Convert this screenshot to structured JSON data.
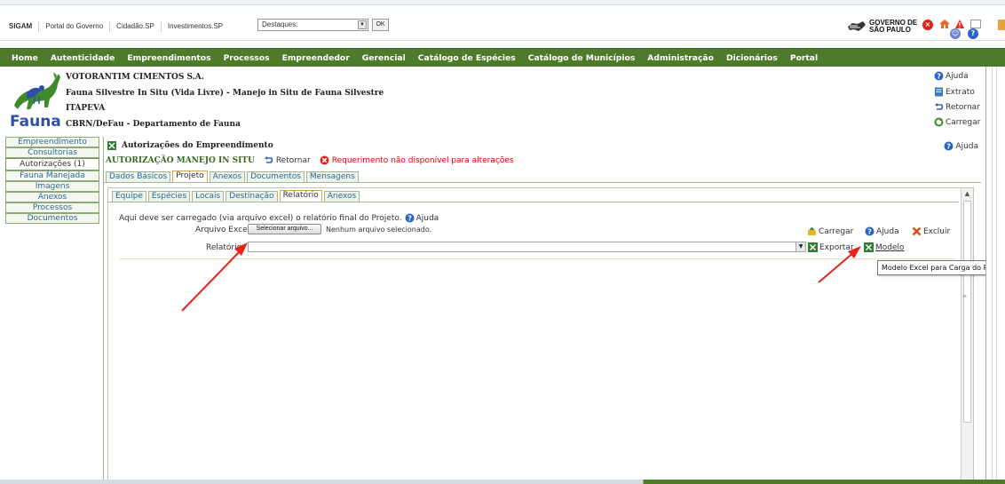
{
  "topbar": {
    "links": [
      "SIGAM",
      "Portal do Governo",
      "Cidadão.SP",
      "Investimentos.SP"
    ],
    "destaques_value": "Destaques:",
    "ok_label": "OK",
    "gov_logo_line1": "GOVERNO DE",
    "gov_logo_line2": "SÃO PAULO"
  },
  "mainnav": {
    "items": [
      "Home",
      "Autenticidade",
      "Empreendimentos",
      "Processos",
      "Empreendedor",
      "Gerencial",
      "Catálogo de Espécies",
      "Catálogo de Municípios",
      "Administração",
      "Dicionários",
      "Portal"
    ]
  },
  "header": {
    "company": "VOTORANTIM CIMENTOS S.A.",
    "activity": "Fauna Silvestre In Situ (Vida Livre) - Manejo in Situ de Fauna Silvestre",
    "city": "ITAPEVA",
    "department": "CBRN/DeFau - Departamento de Fauna",
    "logo_text": "Fauna",
    "actions": [
      "Ajuda",
      "Extrato",
      "Retornar",
      "Carregar"
    ]
  },
  "leftmenu": {
    "items": [
      "Empreendimento",
      "Consultorias",
      "Autorizações (1)",
      "Fauna Manejada",
      "Imagens",
      "Anexos",
      "Processos",
      "Documentos"
    ]
  },
  "content": {
    "section_title": "Autorizações do Empreendimento",
    "help_label": "Ajuda",
    "auth_title": "AUTORIZAÇÃO MANEJO IN SITU",
    "return_label": "Retornar",
    "warning": "Requerimento não disponível para alterações",
    "tabs": [
      "Dados Básicos",
      "Projeto",
      "Anexos",
      "Documentos",
      "Mensagens"
    ],
    "subtabs": [
      "Equipe",
      "Espécies",
      "Locais",
      "Destinação",
      "Relatório",
      "Anexos"
    ],
    "intro_text": "Aqui deve ser carregado (via arquivo excel) o relatório final do Projeto.",
    "intro_help": "Ajuda",
    "excel_label": "Arquivo Excel:",
    "file_button": "Selecionar arquivo...",
    "file_status": "Nenhum arquivo selecionado.",
    "relatorio_label": "Relatório",
    "actions": {
      "carregar": "Carregar",
      "ajuda": "Ajuda",
      "excluir": "Excluir",
      "exportar": "Exportar",
      "modelo": "Modelo"
    },
    "tooltip": "Modelo Excel para Carga do Relatório"
  },
  "colors": {
    "nav_green": "#4f7a2b",
    "link_blue": "#2b6a97",
    "warning_red": "#e00000",
    "arrow_red": "#e8221b"
  }
}
